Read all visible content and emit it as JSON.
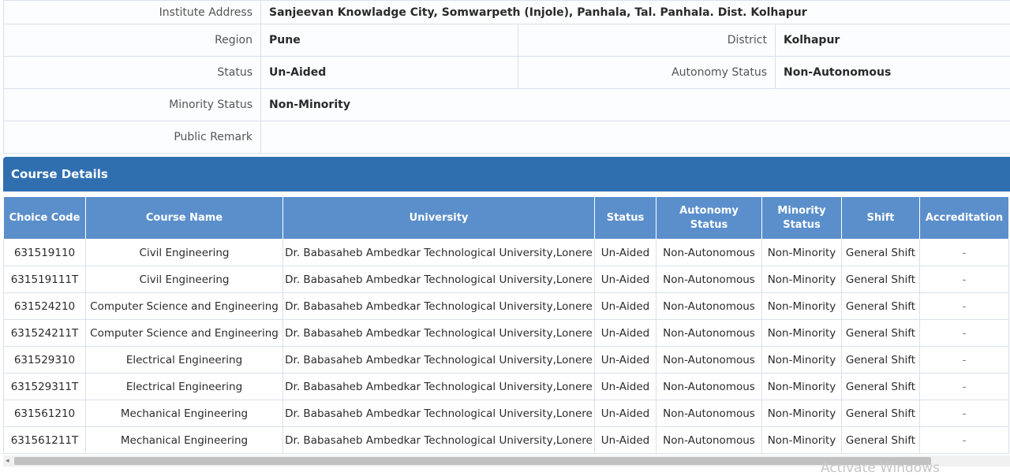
{
  "institute": {
    "address_label": "Institute Address",
    "address_value": "Sanjeevan Knowladge City, Somwarpeth (Injole), Panhala, Tal. Panhala. Dist. Kolhapur",
    "region_label": "Region",
    "region_value": "Pune",
    "district_label": "District",
    "district_value": "Kolhapur",
    "status_label": "Status",
    "status_value": "Un-Aided",
    "autonomy_label": "Autonomy Status",
    "autonomy_value": "Non-Autonomous",
    "minority_label": "Minority Status",
    "minority_value": "Non-Minority",
    "remark_label": "Public Remark",
    "remark_value": ""
  },
  "course_section": {
    "title": "Course Details",
    "columns": [
      "Choice Code",
      "Course Name",
      "University",
      "Status",
      "Autonomy Status",
      "Minority Status",
      "Shift",
      "Accreditation"
    ],
    "rows": [
      [
        "631519110",
        "Civil Engineering",
        "Dr. Babasaheb Ambedkar Technological University,Lonere",
        "Un-Aided",
        "Non-Autonomous",
        "Non-Minority",
        "General Shift",
        "-"
      ],
      [
        "631519111T",
        "Civil Engineering",
        "Dr. Babasaheb Ambedkar Technological University,Lonere",
        "Un-Aided",
        "Non-Autonomous",
        "Non-Minority",
        "General Shift",
        "-"
      ],
      [
        "631524210",
        "Computer Science and Engineering",
        "Dr. Babasaheb Ambedkar Technological University,Lonere",
        "Un-Aided",
        "Non-Autonomous",
        "Non-Minority",
        "General Shift",
        "-"
      ],
      [
        "631524211T",
        "Computer Science and Engineering",
        "Dr. Babasaheb Ambedkar Technological University,Lonere",
        "Un-Aided",
        "Non-Autonomous",
        "Non-Minority",
        "General Shift",
        "-"
      ],
      [
        "631529310",
        "Electrical Engineering",
        "Dr. Babasaheb Ambedkar Technological University,Lonere",
        "Un-Aided",
        "Non-Autonomous",
        "Non-Minority",
        "General Shift",
        "-"
      ],
      [
        "631529311T",
        "Electrical Engineering",
        "Dr. Babasaheb Ambedkar Technological University,Lonere",
        "Un-Aided",
        "Non-Autonomous",
        "Non-Minority",
        "General Shift",
        "-"
      ],
      [
        "631561210",
        "Mechanical Engineering",
        "Dr. Babasaheb Ambedkar Technological University,Lonere",
        "Un-Aided",
        "Non-Autonomous",
        "Non-Minority",
        "General Shift",
        "-"
      ],
      [
        "631561211T",
        "Mechanical Engineering",
        "Dr. Babasaheb Ambedkar Technological University,Lonere",
        "Un-Aided",
        "Non-Autonomous",
        "Non-Minority",
        "General Shift",
        "-"
      ]
    ]
  },
  "scrollbar": {
    "left_arrow": "◂"
  },
  "watermark": "Activate Windows",
  "colors": {
    "header_bar": "#2f6fb0",
    "table_header": "#5b8fcb",
    "border": "#d9e1ec"
  }
}
